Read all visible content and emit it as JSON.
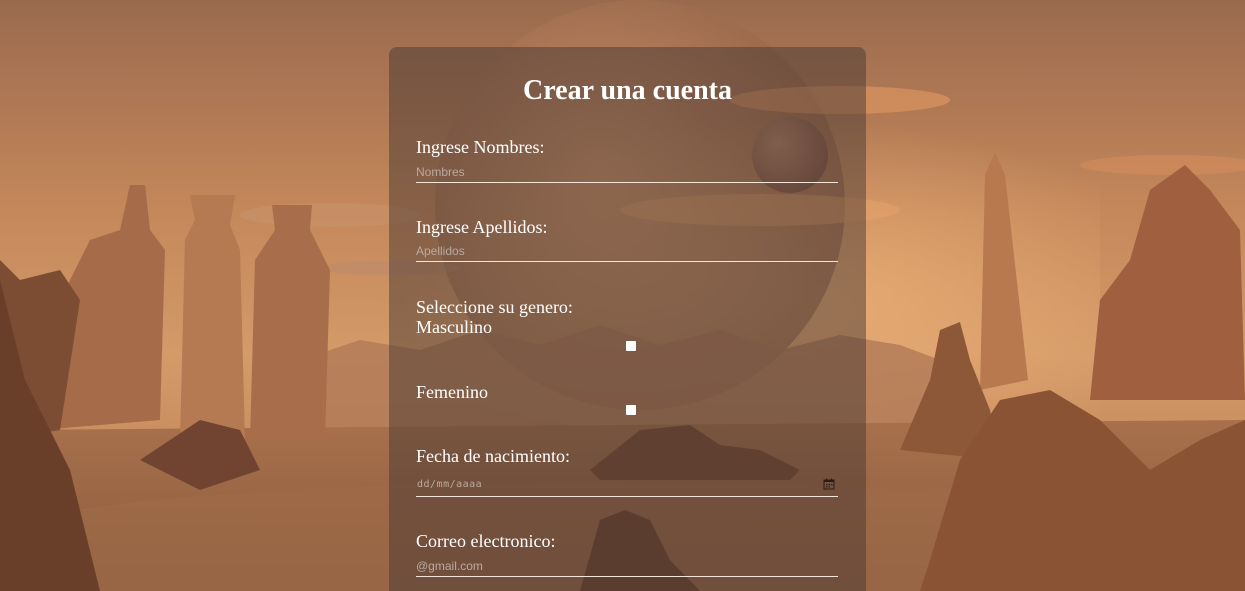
{
  "form": {
    "title": "Crear una cuenta",
    "nombres": {
      "label": "Ingrese Nombres:",
      "placeholder": "Nombres",
      "value": ""
    },
    "apellidos": {
      "label": "Ingrese Apellidos:",
      "placeholder": "Apellidos",
      "value": ""
    },
    "genero": {
      "label": "Seleccione su genero:",
      "options": [
        {
          "label": "Masculino",
          "checked": false
        },
        {
          "label": "Femenino",
          "checked": false
        }
      ]
    },
    "fecha": {
      "label": "Fecha de nacimiento:",
      "placeholder": "dd/mm/aaaa",
      "icon": "calendar-icon"
    },
    "correo": {
      "label": "Correo electronico:",
      "placeholder": "@gmail.com",
      "value": ""
    }
  },
  "colors": {
    "panel_overlay": "rgba(70,55,50,0.48)",
    "text": "#ffffff",
    "placeholder": "#b9aaa0",
    "underline": "#f2e6dc"
  }
}
